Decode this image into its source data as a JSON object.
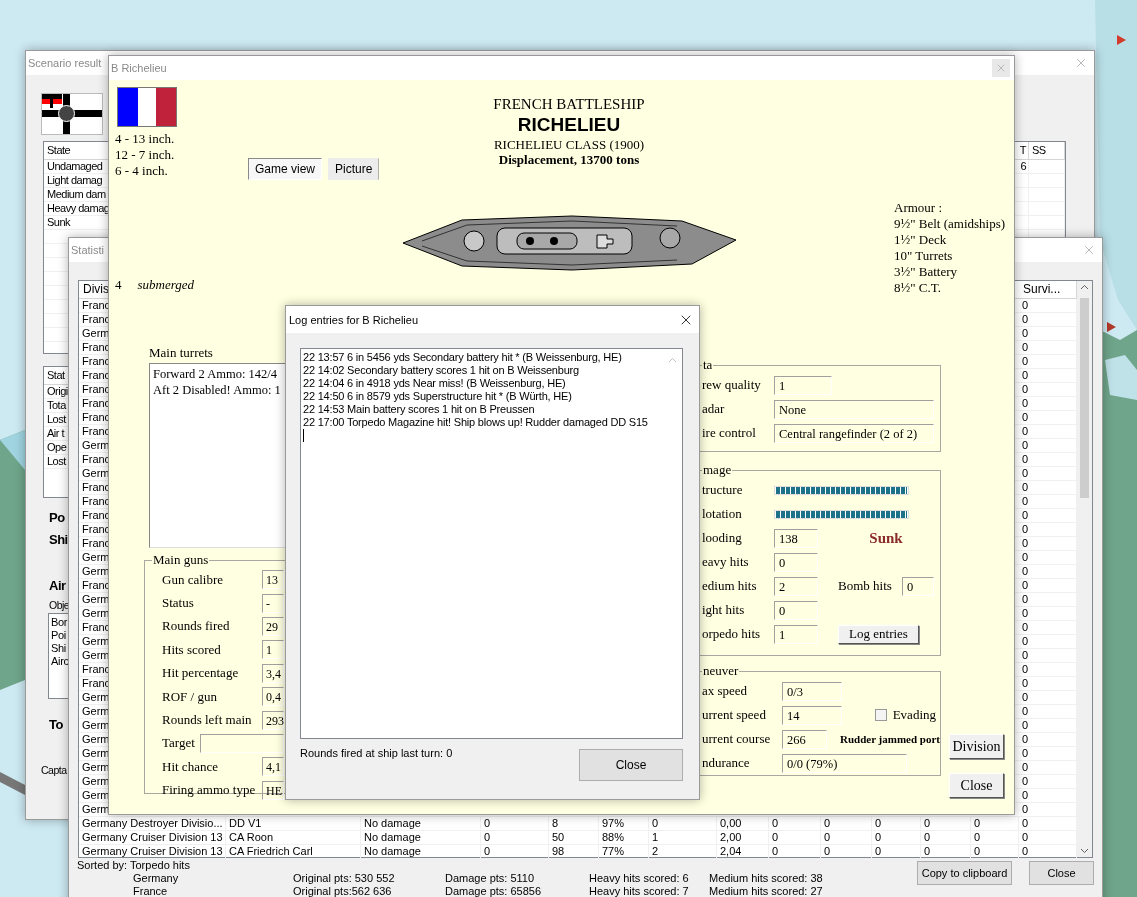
{
  "scenario_results": {
    "title": "Scenario result",
    "state_table": {
      "columns": [
        "State",
        "T",
        "SS"
      ],
      "rows": [
        {
          "state": "Undamaged",
          "lt": "6"
        },
        {
          "state": "Light damag"
        },
        {
          "state": "Medium dam"
        },
        {
          "state": "Heavy damag"
        },
        {
          "state": "Sunk"
        }
      ]
    },
    "points_table": {
      "column": "Stat",
      "rows": [
        "Origi",
        "Tota",
        "Lost",
        "Air t",
        "Ope",
        "Lost"
      ]
    },
    "ports_heading": "Po",
    "ships_heading": "Shi",
    "air": {
      "heading": "Air",
      "objective_label": "Obje",
      "objectives": [
        "Bor",
        "Poi",
        "Shi",
        "Airc"
      ]
    },
    "total_heading": "To",
    "caption_label": "Capta"
  },
  "statistics": {
    "title": "Statisti",
    "first_column": "Divis",
    "last_column": "Survi...",
    "rows": [
      {
        "division": "Franc",
        "survivors": "0"
      },
      {
        "division": "Franc",
        "survivors": "0"
      },
      {
        "division": "Germ",
        "survivors": "0"
      },
      {
        "division": "Franc",
        "survivors": "0"
      },
      {
        "division": "Franc",
        "survivors": "0"
      },
      {
        "division": "Franc",
        "survivors": "0"
      },
      {
        "division": "Franc",
        "survivors": "0"
      },
      {
        "division": "Franc",
        "survivors": "0"
      },
      {
        "division": "Franc",
        "survivors": "0"
      },
      {
        "division": "Franc",
        "survivors": "0"
      },
      {
        "division": "Germ",
        "survivors": "0"
      },
      {
        "division": "Franc",
        "survivors": "0"
      },
      {
        "division": "Germ",
        "survivors": "0"
      },
      {
        "division": "Franc",
        "survivors": "0"
      },
      {
        "division": "Franc",
        "survivors": "0"
      },
      {
        "division": "Franc",
        "survivors": "0"
      },
      {
        "division": "Franc",
        "survivors": "0"
      },
      {
        "division": "Franc",
        "survivors": "0"
      },
      {
        "division": "Germ",
        "survivors": "0"
      },
      {
        "division": "Germ",
        "survivors": "0"
      },
      {
        "division": "Franc",
        "survivors": "0"
      },
      {
        "division": "Germ",
        "survivors": "0"
      },
      {
        "division": "Germ",
        "survivors": "0"
      },
      {
        "division": "Franc",
        "survivors": "0"
      },
      {
        "division": "Germ",
        "survivors": "0"
      },
      {
        "division": "Germ",
        "survivors": "0"
      },
      {
        "division": "Franc",
        "survivors": "0"
      },
      {
        "division": "Franc",
        "survivors": "0"
      },
      {
        "division": "Germ",
        "survivors": "0"
      },
      {
        "division": "Germ",
        "survivors": "0"
      },
      {
        "division": "Germ",
        "survivors": "0"
      },
      {
        "division": "Germ",
        "survivors": "0"
      },
      {
        "division": "Germ",
        "survivors": "0"
      },
      {
        "division": "Germ",
        "survivors": "0"
      },
      {
        "division": "Germ",
        "survivors": "0"
      },
      {
        "division": "Germ",
        "survivors": "0"
      },
      {
        "division": "Germ",
        "survivors": "0"
      },
      {
        "division": "Germany Destroyer Divisio...",
        "ship": "DD V1",
        "state": "No damage",
        "values": [
          "0",
          "8",
          "97%",
          "0",
          "0,00",
          "0",
          "0",
          "0",
          "0",
          "0"
        ],
        "survivors": "0"
      },
      {
        "division": "Germany Cruiser Division 13",
        "ship": "CA Roon",
        "state": "No damage",
        "values": [
          "0",
          "50",
          "88%",
          "1",
          "2,00",
          "0",
          "0",
          "0",
          "0",
          "0"
        ],
        "survivors": "0"
      },
      {
        "division": "Germany Cruiser Division 13",
        "ship": "CA Friedrich Carl",
        "state": "No damage",
        "values": [
          "0",
          "98",
          "77%",
          "2",
          "2,04",
          "0",
          "0",
          "0",
          "0",
          "0"
        ],
        "survivors": "0"
      }
    ],
    "sorted_by": "Sorted by: Torpedo hits",
    "totals": [
      {
        "side": "Germany",
        "original": "Original pts: 530 552",
        "damage": "Damage pts:  5110",
        "heavy": "Heavy hits scored: 6",
        "medium": "Medium hits scored: 38"
      },
      {
        "side": "France",
        "original": "Original pts:562 636",
        "damage": "Damage pts:  65856",
        "heavy": "Heavy hits scored: 7",
        "medium": "Medium hits scored: 27"
      }
    ],
    "buttons": [
      "Copy to clipboard",
      "Close"
    ]
  },
  "ship_window": {
    "title": "B Richelieu",
    "guns": [
      "4 - 13 inch.",
      "12 - 7 inch.",
      "6 - 4 inch."
    ],
    "tabs": [
      {
        "label": "Game view",
        "selected": true
      },
      {
        "label": "Picture",
        "selected": false
      }
    ],
    "type_line": "FRENCH BATTLESHIP",
    "name": "RICHELIEU",
    "class_line": "RICHELIEU CLASS (1900)",
    "displacement": "Displacement, 13700 tons",
    "armour": [
      "Armour :",
      "9½\" Belt (amidships)",
      "1½\" Deck",
      "10\" Turrets",
      "3½\" Battery",
      "8½\" C.T."
    ],
    "submerged": {
      "count": "4",
      "label": "submerged"
    },
    "main_turrets": {
      "label": "Main turrets",
      "items": [
        "Forward 2 Ammo: 142/4",
        "Aft 2 Disabled! Ammo: 1"
      ]
    },
    "main_guns": {
      "title": "Main guns",
      "rows": [
        {
          "label": "Gun calibre",
          "value": "13"
        },
        {
          "label": "Status",
          "value": "-"
        },
        {
          "label": "Rounds fired",
          "value": "29"
        },
        {
          "label": "Hits scored",
          "value": "1"
        },
        {
          "label": "Hit percentage",
          "value": "3,4"
        },
        {
          "label": "ROF / gun",
          "value": "0,4"
        },
        {
          "label": "Rounds left main",
          "value": "293"
        },
        {
          "label": "Target",
          "kind": "wide"
        },
        {
          "label": "Hit chance",
          "value": "4,1"
        },
        {
          "label": "Firing ammo type",
          "value": "HE"
        }
      ]
    },
    "data": {
      "title": "ta",
      "rows": [
        {
          "label": "rew quality",
          "value": "1",
          "kind": "short"
        },
        {
          "label": "adar",
          "value": "None",
          "kind": "long"
        },
        {
          "label": "ire control",
          "value": "Central rangefinder (2 of 2)",
          "kind": "long"
        }
      ]
    },
    "damage": {
      "title": "mage",
      "rows": [
        {
          "kind": "bar",
          "label": "tructure",
          "level": 1
        },
        {
          "kind": "bar",
          "label": "lotation",
          "level": 1
        },
        {
          "kind": "field",
          "label": "looding",
          "value": "138"
        },
        {
          "kind": "field",
          "label": "eavy hits",
          "value": "0"
        },
        {
          "kind": "field",
          "label": "edium hits",
          "value": "2"
        },
        {
          "kind": "field",
          "label": "ight hits",
          "value": "0"
        },
        {
          "kind": "field",
          "label": "orpedo hits",
          "value": "1"
        }
      ],
      "status": "Sunk",
      "bomb_hits": {
        "label": "Bomb hits",
        "value": "0"
      },
      "log_button": "Log entries"
    },
    "maneuver": {
      "title": "neuver",
      "max_speed": {
        "label": "ax speed",
        "value": "0/3"
      },
      "current_speed": {
        "label": "urrent speed",
        "value": "14"
      },
      "evading": {
        "label": "Evading",
        "checked": false
      },
      "current_course": {
        "label": "urrent course",
        "value": "266"
      },
      "rudder": "Rudder jammed port",
      "endurance": {
        "label": "ndurance",
        "value": "0/0 (79%)"
      }
    },
    "buttons": [
      "Division",
      "Close"
    ]
  },
  "log_window": {
    "title": "Log entries for B Richelieu",
    "entries": [
      "22 13:57  6 in 5456 yds Secondary battery hit *  (B Weissenburg, HE)",
      "22 14:02   Secondary battery scores 1 hit on B Weissenburg",
      "22 14:04  6 in 4918 yds Near miss! (B Weissenburg, HE)",
      "22 14:50  6 in 8579 yds Superstructure hit *  (B Würth, HE)",
      "22 14:53   Main battery scores 1 hit on B Preussen",
      "22 17:00  Torpedo Magazine hit! Ship blows up! Rudder damaged DD S15"
    ],
    "footer": "Rounds fired at ship last turn: 0",
    "button": "Close"
  }
}
